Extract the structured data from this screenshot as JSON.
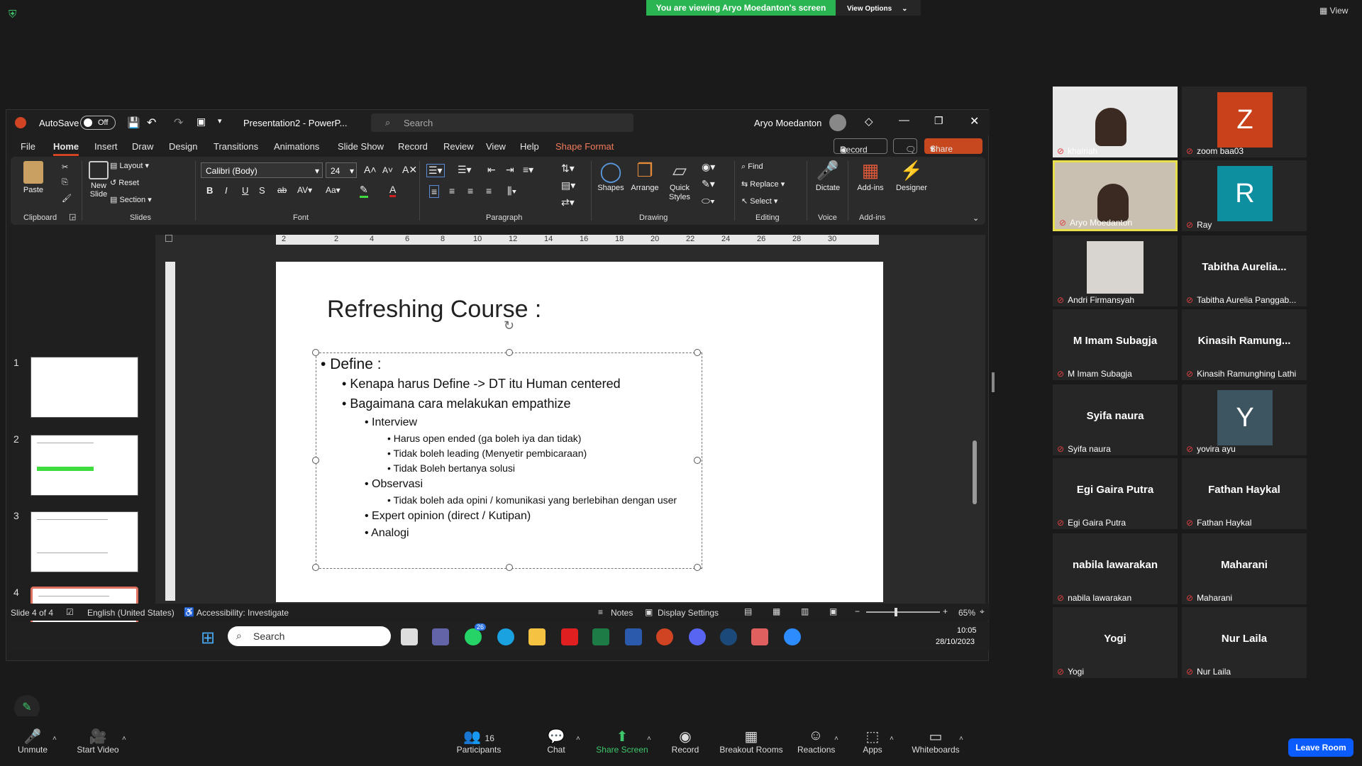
{
  "zoom_top": {
    "viewing_banner": "You are viewing Aryo Moedanton's screen",
    "view_options": "View Options",
    "view": "View"
  },
  "ppt": {
    "autosave": "AutoSave",
    "autosave_state": "Off",
    "filename": "Presentation2 - PowerP...",
    "search_placeholder": "Search",
    "user": "Aryo Moedanton",
    "record_btn": "Record",
    "share_btn": "Share",
    "menu": [
      "File",
      "Home",
      "Insert",
      "Draw",
      "Design",
      "Transitions",
      "Animations",
      "Slide Show",
      "Record",
      "Review",
      "View",
      "Help",
      "Shape Format"
    ],
    "ribbon": {
      "paste": "Paste",
      "new_slide": "New Slide",
      "layout": "Layout",
      "reset": "Reset",
      "section": "Section",
      "font_name": "Calibri (Body)",
      "font_size": "24",
      "shapes": "Shapes",
      "arrange": "Arrange",
      "quick_styles": "Quick Styles",
      "find": "Find",
      "replace": "Replace",
      "select": "Select",
      "dictate": "Dictate",
      "addins": "Add-ins",
      "designer": "Designer",
      "groups": [
        "Clipboard",
        "Slides",
        "Font",
        "Paragraph",
        "Drawing",
        "Editing",
        "Voice",
        "Add-ins"
      ]
    },
    "ruler_ticks": [
      "2",
      "2",
      "4",
      "6",
      "8",
      "10",
      "12",
      "14",
      "16",
      "18",
      "20",
      "22",
      "24",
      "26",
      "28",
      "30"
    ],
    "thumb_numbers": [
      "1",
      "2",
      "3",
      "4"
    ],
    "slide": {
      "title": "Refreshing Course :",
      "bullets": [
        {
          "level": 1,
          "text": "Define :"
        },
        {
          "level": 2,
          "text": "Kenapa harus Define -> DT itu Human centered"
        },
        {
          "level": 2,
          "text": "Bagaimana cara melakukan empathize"
        },
        {
          "level": 3,
          "text": "Interview"
        },
        {
          "level": 4,
          "text": "Harus open ended (ga boleh iya dan tidak)"
        },
        {
          "level": 4,
          "text": "Tidak boleh leading (Menyetir pembicaraan)"
        },
        {
          "level": 4,
          "text": "Tidak Boleh bertanya solusi"
        },
        {
          "level": 3,
          "text": "Observasi"
        },
        {
          "level": 4,
          "text": "Tidak boleh ada opini / komunikasi yang berlebihan dengan user"
        },
        {
          "level": 3,
          "text": "Expert opinion (direct / Kutipan)"
        },
        {
          "level": 3,
          "text": "Analogi"
        }
      ]
    },
    "status": {
      "slide_of": "Slide 4 of 4",
      "language": "English (United States)",
      "accessibility": "Accessibility: Investigate",
      "notes": "Notes",
      "display_settings": "Display Settings",
      "zoom": "65%"
    },
    "taskbar": {
      "search_placeholder": "Search",
      "time": "10:05",
      "date": "28/10/2023",
      "whatsapp_badge": "26"
    }
  },
  "participants": [
    {
      "name": "",
      "sub": "khairiah",
      "type": "video"
    },
    {
      "name": "Z",
      "sub": "zoom baa03",
      "type": "avatar",
      "color": "#c8411b"
    },
    {
      "name": "",
      "sub": "Aryo Moedanton",
      "type": "video"
    },
    {
      "name": "R",
      "sub": "Ray",
      "type": "avatar",
      "color": "#0e8fa0"
    },
    {
      "name": "",
      "sub": "Andri Firmansyah",
      "type": "photo"
    },
    {
      "name": "Tabitha  Aurelia...",
      "sub": "Tabitha Aurelia Panggab...",
      "type": "name"
    },
    {
      "name": "M Imam Subagja",
      "sub": "M Imam Subagja",
      "type": "name"
    },
    {
      "name": "Kinasih  Ramung...",
      "sub": "Kinasih Ramunghing Lathi",
      "type": "name"
    },
    {
      "name": "Syifa naura",
      "sub": "Syifa naura",
      "type": "name"
    },
    {
      "name": "Y",
      "sub": "yovira ayu",
      "type": "avatar",
      "color": "#3d5560"
    },
    {
      "name": "Egi Gaira Putra",
      "sub": "Egi Gaira Putra",
      "type": "name"
    },
    {
      "name": "Fathan Haykal",
      "sub": "Fathan Haykal",
      "type": "name"
    },
    {
      "name": "nabila lawarakan",
      "sub": "nabila lawarakan",
      "type": "name"
    },
    {
      "name": "Maharani",
      "sub": "Maharani",
      "type": "name"
    },
    {
      "name": "Yogi",
      "sub": "Yogi",
      "type": "name"
    },
    {
      "name": "Nur Laila",
      "sub": "Nur Laila",
      "type": "name"
    }
  ],
  "toolbar": {
    "unmute": "Unmute",
    "start_video": "Start Video",
    "participants": "Participants",
    "participant_count": "16",
    "chat": "Chat",
    "share_screen": "Share Screen",
    "record": "Record",
    "breakout": "Breakout Rooms",
    "reactions": "Reactions",
    "apps": "Apps",
    "whiteboards": "Whiteboards",
    "leave": "Leave Room"
  }
}
